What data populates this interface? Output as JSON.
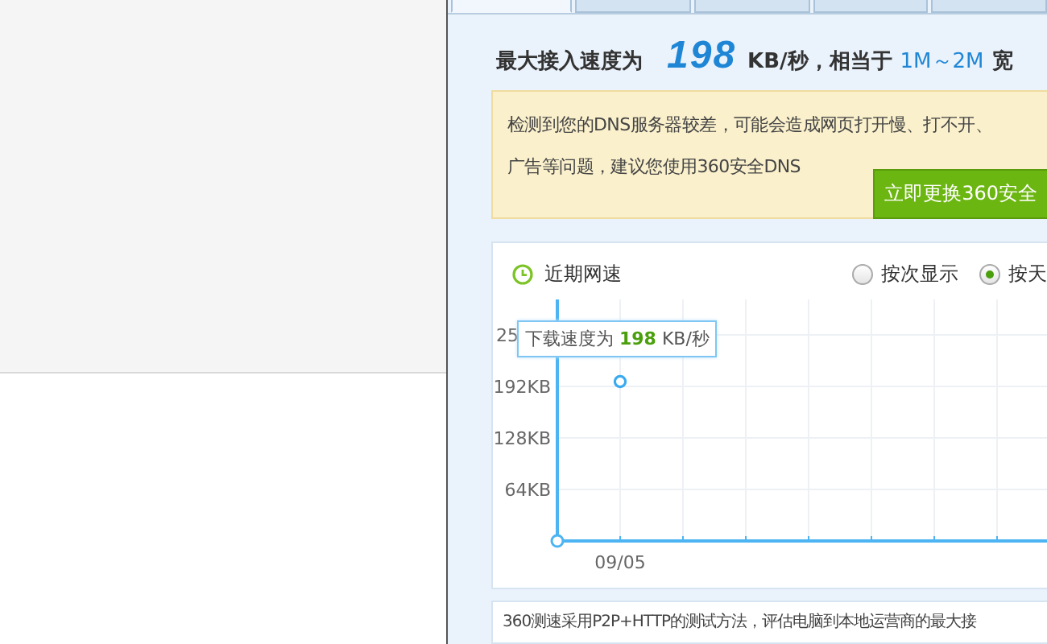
{
  "tabs": [
    {
      "selected": true
    },
    {
      "selected": false
    },
    {
      "selected": false
    },
    {
      "selected": false
    },
    {
      "selected": false
    }
  ],
  "headline": {
    "label": "最大接入速度为",
    "speed": "198",
    "unit": "KB/秒，相当于",
    "bandwidth": "1M～2M",
    "suffix": "宽"
  },
  "notice": {
    "lines": [
      "检测到您的DNS服务器较差，可能会造成网页打开慢、打不开、",
      "广告等问题，建议您使用360安全DNS"
    ],
    "button": "立即更换360安全"
  },
  "history": {
    "title": "近期网速",
    "modes": [
      {
        "label": "按次显示",
        "selected": false
      },
      {
        "label": "按天",
        "selected": true
      }
    ],
    "tooltip": "下载速度为 **198** KB/秒",
    "partial_tick_label": "25",
    "chart_data": {
      "type": "line",
      "categories": [
        "09/05"
      ],
      "series": [
        {
          "color": "#3aaaf0",
          "values": [
            198
          ],
          "marker": "o"
        }
      ],
      "ylim": [
        0,
        300
      ],
      "grid": true,
      "yticks": [
        {
          "value": 64,
          "label": "64KB"
        },
        {
          "value": 128,
          "label": "128KB"
        },
        {
          "value": 192,
          "label": "192KB"
        }
      ]
    }
  },
  "footer_text": "360测速采用P2P+HTTP的测试方法，评估电脑到本地运营商的最大接"
}
